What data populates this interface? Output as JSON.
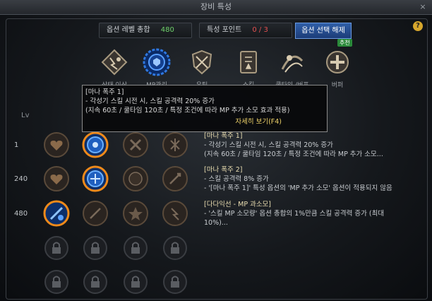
{
  "window": {
    "title": "장비 특성",
    "close": "×"
  },
  "summary": {
    "level_label": "옵션 레벨 총합",
    "level_value": "480",
    "points_label": "특성 포인트",
    "points_value": "0 / 3",
    "reset_button": "옵션 선택 해제",
    "help": "?"
  },
  "categories": [
    {
      "label": "상태 이상",
      "icon": "status-effect-icon"
    },
    {
      "label": "MP관리",
      "icon": "mp-gear-icon"
    },
    {
      "label": "유틸",
      "icon": "shield-sword-icon"
    },
    {
      "label": "스킬",
      "icon": "skillbook-icon"
    },
    {
      "label": "쿨타임 /버프",
      "icon": "cooldown-icon"
    },
    {
      "label": "버퍼",
      "icon": "buffer-icon",
      "tag": "추천"
    }
  ],
  "tooltip": {
    "title": "[마나 폭주 1]",
    "line1": "- 각성기 스킬 시전 시, 스킬 공격력 20% 증가",
    "line2": "(지속 60초 / 쿨타임 120초 / 특정 조건에 따라 MP 추가 소모 효과 적용)",
    "link": "자세히 보기(F4)"
  },
  "level_header": "Lv",
  "rows": [
    {
      "lv": "1",
      "title": "[마나 폭주 1]",
      "l1": "- 각성기 스킬 시전 시, 스킬 공격력 20% 증가",
      "l2": "(지속 60초 / 쿨타임 120초 / 특정 조건에 따라 MP 추가 소모..."
    },
    {
      "lv": "240",
      "title": "[마나 폭주 2]",
      "l1": "- 스킬 공격력 8% 증가",
      "l2": "- '[마나 폭주 1]' 특성 옵션의 'MP 추가 소모' 옵션이 적용되지 않음"
    },
    {
      "lv": "480",
      "title": "[다다익선 - MP 과소모]",
      "l1": "- '스킬 MP 소모량' 옵션 총합의 1%만큼 스킬 공격력 증가 (최대",
      "l2": "10%)..."
    }
  ],
  "colors": {
    "accent": "#2f78e0",
    "selected_ring": "#f08a1a",
    "green": "#6fd26a",
    "red": "#e45050"
  }
}
